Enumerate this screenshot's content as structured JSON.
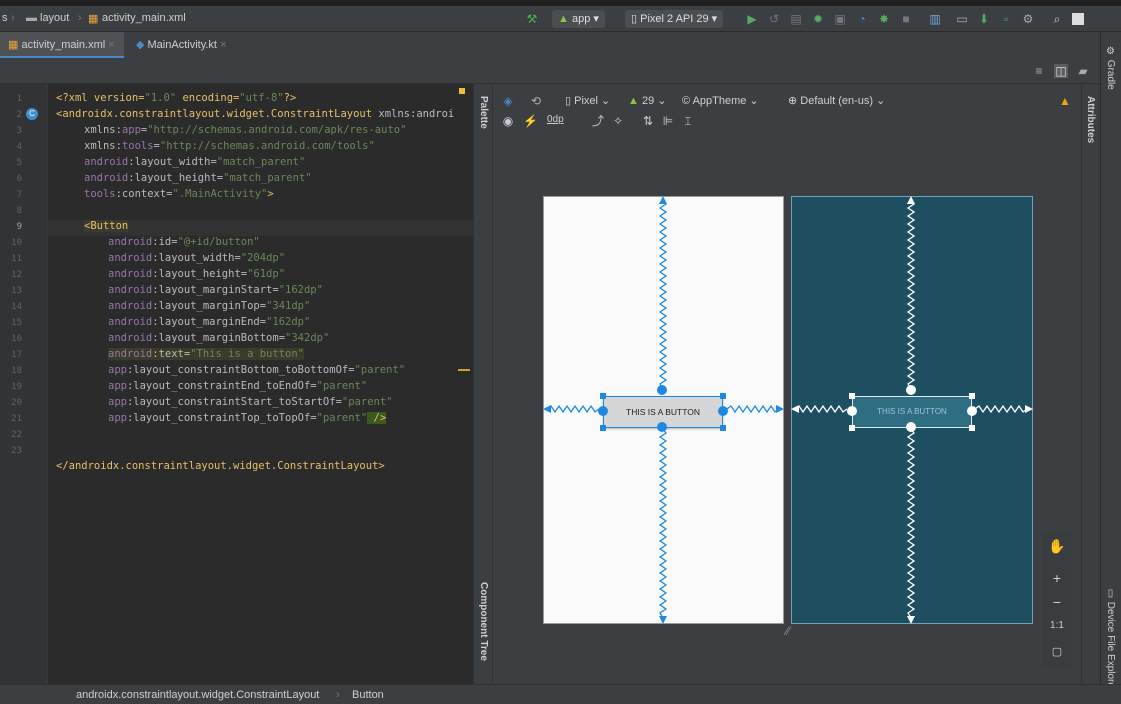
{
  "breadcrumbs": [
    "s",
    "layout",
    "activity_main.xml"
  ],
  "run_config": {
    "module": "app",
    "device": "Pixel 2 API 29"
  },
  "tabs": [
    {
      "label": "activity_main.xml",
      "active": true
    },
    {
      "label": "MainActivity.kt",
      "active": false
    }
  ],
  "line_numbers": [
    "1",
    "2",
    "3",
    "4",
    "5",
    "6",
    "7",
    "8",
    "9",
    "10",
    "11",
    "12",
    "13",
    "14",
    "15",
    "16",
    "17",
    "18",
    "19",
    "20",
    "21",
    "22",
    "23"
  ],
  "code": {
    "l1": {
      "a": "<?xml version=",
      "b": "\"1.0\"",
      "c": " encoding=",
      "d": "\"utf-8\"",
      "e": "?>"
    },
    "l2": {
      "a": "<androidx.constraintlayout.widget.ConstraintLayout",
      "b": " xmlns:androi"
    },
    "l3": {
      "a": "xmlns:",
      "b": "app",
      "c": "=",
      "d": "\"http://schemas.android.com/apk/res-auto\""
    },
    "l4": {
      "a": "xmlns:",
      "b": "tools",
      "c": "=",
      "d": "\"http://schemas.android.com/tools\""
    },
    "l5": {
      "a": "android",
      "b": ":layout_width=",
      "c": "\"match_parent\""
    },
    "l6": {
      "a": "android",
      "b": ":layout_height=",
      "c": "\"match_parent\""
    },
    "l7": {
      "a": "tools",
      "b": ":context=",
      "c": "\".MainActivity\"",
      "d": ">"
    },
    "l9": "<Button",
    "l10": {
      "a": "android",
      "b": ":id=",
      "c": "\"@+id/button\""
    },
    "l11": {
      "a": "android",
      "b": ":layout_width=",
      "c": "\"204dp\""
    },
    "l12": {
      "a": "android",
      "b": ":layout_height=",
      "c": "\"61dp\""
    },
    "l13": {
      "a": "android",
      "b": ":layout_marginStart=",
      "c": "\"162dp\""
    },
    "l14": {
      "a": "android",
      "b": ":layout_marginTop=",
      "c": "\"341dp\""
    },
    "l15": {
      "a": "android",
      "b": ":layout_marginEnd=",
      "c": "\"162dp\""
    },
    "l16": {
      "a": "android",
      "b": ":layout_marginBottom=",
      "c": "\"342dp\""
    },
    "l17": {
      "a": "android",
      "b": ":text=",
      "c": "\"This is a button\""
    },
    "l18": {
      "a": "app",
      "b": ":layout_constraintBottom_toBottomOf=",
      "c": "\"parent\""
    },
    "l19": {
      "a": "app",
      "b": ":layout_constraintEnd_toEndOf=",
      "c": "\"parent\""
    },
    "l20": {
      "a": "app",
      "b": ":layout_constraintStart_toStartOf=",
      "c": "\"parent\""
    },
    "l21": {
      "a": "app",
      "b": ":layout_constraintTop_toTopOf=",
      "c": "\"parent\"",
      "d": " />"
    },
    "l23": "</androidx.constraintlayout.widget.ConstraintLayout>"
  },
  "palette_label": "Palette",
  "component_tree_label": "Component Tree",
  "design_toolbar": {
    "device": "Pixel",
    "api": "29",
    "theme": "AppTheme",
    "locale": "Default (en-us)",
    "margin": "0dp"
  },
  "button_text": "THIS IS A BUTTON",
  "zoom": {
    "plus": "+",
    "minus": "−",
    "one_to_one": "1:1"
  },
  "right_sidebar": {
    "gradle": "Gradle",
    "attributes": "Attributes",
    "device_file_explorer": "Device File Explorer"
  },
  "status_breadcrumb": [
    "androidx.constraintlayout.widget.ConstraintLayout",
    "Button"
  ],
  "colors": {
    "accent": "#4a88c7",
    "handle": "#1e88e5",
    "blueprint": "#1d4f60",
    "warning": "#f0a30a"
  }
}
